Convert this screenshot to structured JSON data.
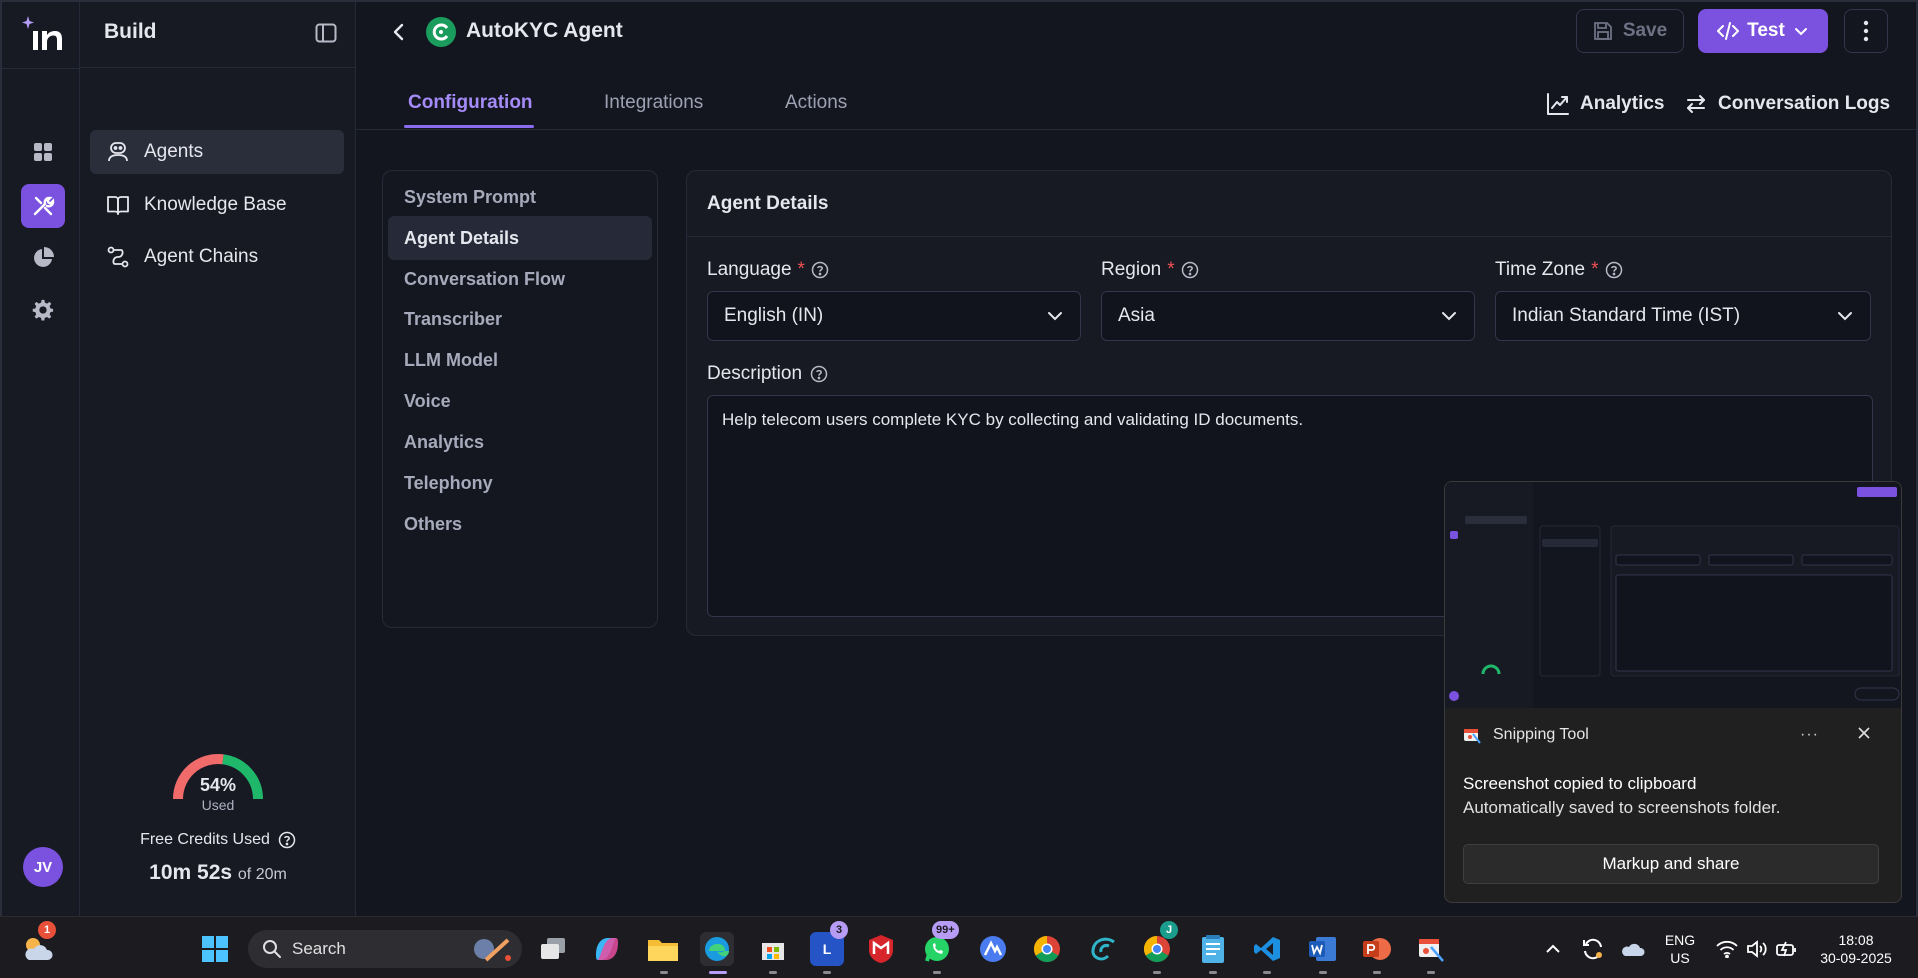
{
  "rail": {
    "avatar_initials": "JV",
    "accent": "#7b52e0"
  },
  "sidebar": {
    "title": "Build",
    "items": [
      {
        "label": "Agents",
        "icon": "agent-icon",
        "active": true
      },
      {
        "label": "Knowledge Base",
        "icon": "book-icon",
        "active": false
      },
      {
        "label": "Agent Chains",
        "icon": "chain-icon",
        "active": false
      }
    ],
    "credits": {
      "percent": "54%",
      "percent_value": 54,
      "used_label": "Used",
      "label": "Free Credits Used",
      "time_used": "10m 52s",
      "time_total": "of 20m"
    }
  },
  "header": {
    "agent_name": "AutoKYC Agent",
    "save_label": "Save",
    "test_label": "Test"
  },
  "tabs": {
    "items": [
      "Configuration",
      "Integrations",
      "Actions"
    ],
    "active": "Configuration",
    "analytics_label": "Analytics",
    "logs_label": "Conversation Logs"
  },
  "settings_menu": {
    "items": [
      "System Prompt",
      "Agent Details",
      "Conversation Flow",
      "Transcriber",
      "LLM Model",
      "Voice",
      "Analytics",
      "Telephony",
      "Others"
    ],
    "active": "Agent Details"
  },
  "agent_details": {
    "title": "Agent Details",
    "language": {
      "label": "Language",
      "required": "*",
      "value": "English (IN)"
    },
    "region": {
      "label": "Region",
      "required": "*",
      "value": "Asia"
    },
    "time_zone": {
      "label": "Time Zone",
      "required": "*",
      "value": "Indian Standard Time (IST)"
    },
    "description": {
      "label": "Description",
      "value": "Help telecom users complete KYC by collecting and validating ID documents."
    }
  },
  "snipping_tool": {
    "app_name": "Snipping Tool",
    "message": "Screenshot copied to clipboard",
    "sub_message": "Automatically saved to screenshots folder.",
    "button_label": "Markup and share",
    "dots": "···"
  },
  "taskbar": {
    "search_placeholder": "Search",
    "weather_badge": "1",
    "badges": {
      "lenovo": "3",
      "whatsapp": "99+",
      "chrome_profile": "J"
    },
    "language": "ENG",
    "region": "US",
    "time": "18:08",
    "date": "30-09-2025"
  }
}
